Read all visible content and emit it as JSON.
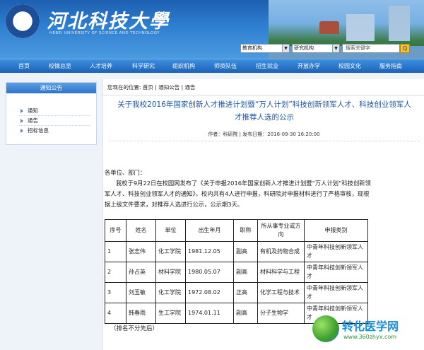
{
  "header": {
    "logo_cn": "河北科技大學",
    "logo_en": "HEBEI UNIVERSITY OF SCIENCE AND TECHNOLOGY",
    "select1": "教育机构",
    "select2": "研究机构",
    "search_placeholder": "搜索关键字",
    "search_button": "Q"
  },
  "nav": [
    "首页",
    "校情总览",
    "人才培养",
    "科学研究",
    "组织机构",
    "师资队伍",
    "招生就业",
    "开放办学",
    "校园文化",
    "服务指南"
  ],
  "sidebar": {
    "title": "通知公告",
    "items": [
      "通知",
      "通告",
      "招标信息"
    ]
  },
  "breadcrumb": {
    "prefix": "您现在的位置:",
    "home": "首页",
    "sep1": "|",
    "section": "通知公告",
    "sep2": "|",
    "current": "通告"
  },
  "article": {
    "title_line1": "关于我校2016年国家创新人才推进计划暨“万人计划”科技创新领军人才、科技创业领军人",
    "title_line2": "才推荐人选的公示",
    "meta": "作者：科研院 | 发布日期：2016-09-30 16:20:00",
    "greeting": "各单位、部门：",
    "para_line1": "我校于9月22日在校园网发布了《关于申报2016年国家创新人才推进计划暨“万人计划”科技创新领",
    "para_line2": "军人才、科技创业领军人才的通知》。校内共有4人进行申报，科研院对申报材料进行了严格审核，现根",
    "para_line3": "据上级文件要求，对推荐人选进行公示，公示期3天。",
    "note": "（排名不分先后）"
  },
  "table": {
    "headers": [
      "序号",
      "姓名",
      "单位",
      "出生年月",
      "职称",
      "所从事专业或方向",
      "申报类别"
    ],
    "rows": [
      [
        "1",
        "张志伟",
        "化工学院",
        "1981.12.05",
        "副高",
        "有机及药物合成",
        "中青年科技创新领军人才"
      ],
      [
        "2",
        "孙占英",
        "材料学院",
        "1980.05.07",
        "副高",
        "材料科学与工程",
        "中青年科技创新领军人才"
      ],
      [
        "3",
        "刘玉敏",
        "化工学院",
        "1972.08.02",
        "正高",
        "化学工程与技术",
        "中青年科技创新领军人才"
      ],
      [
        "4",
        "韩春雨",
        "生工学院",
        "1974.01.11",
        "副高",
        "分子生物学",
        "中青年科技创新领军人才"
      ]
    ]
  },
  "watermark": {
    "cn": "转化医学网",
    "url": "www.360zhyx.com"
  }
}
